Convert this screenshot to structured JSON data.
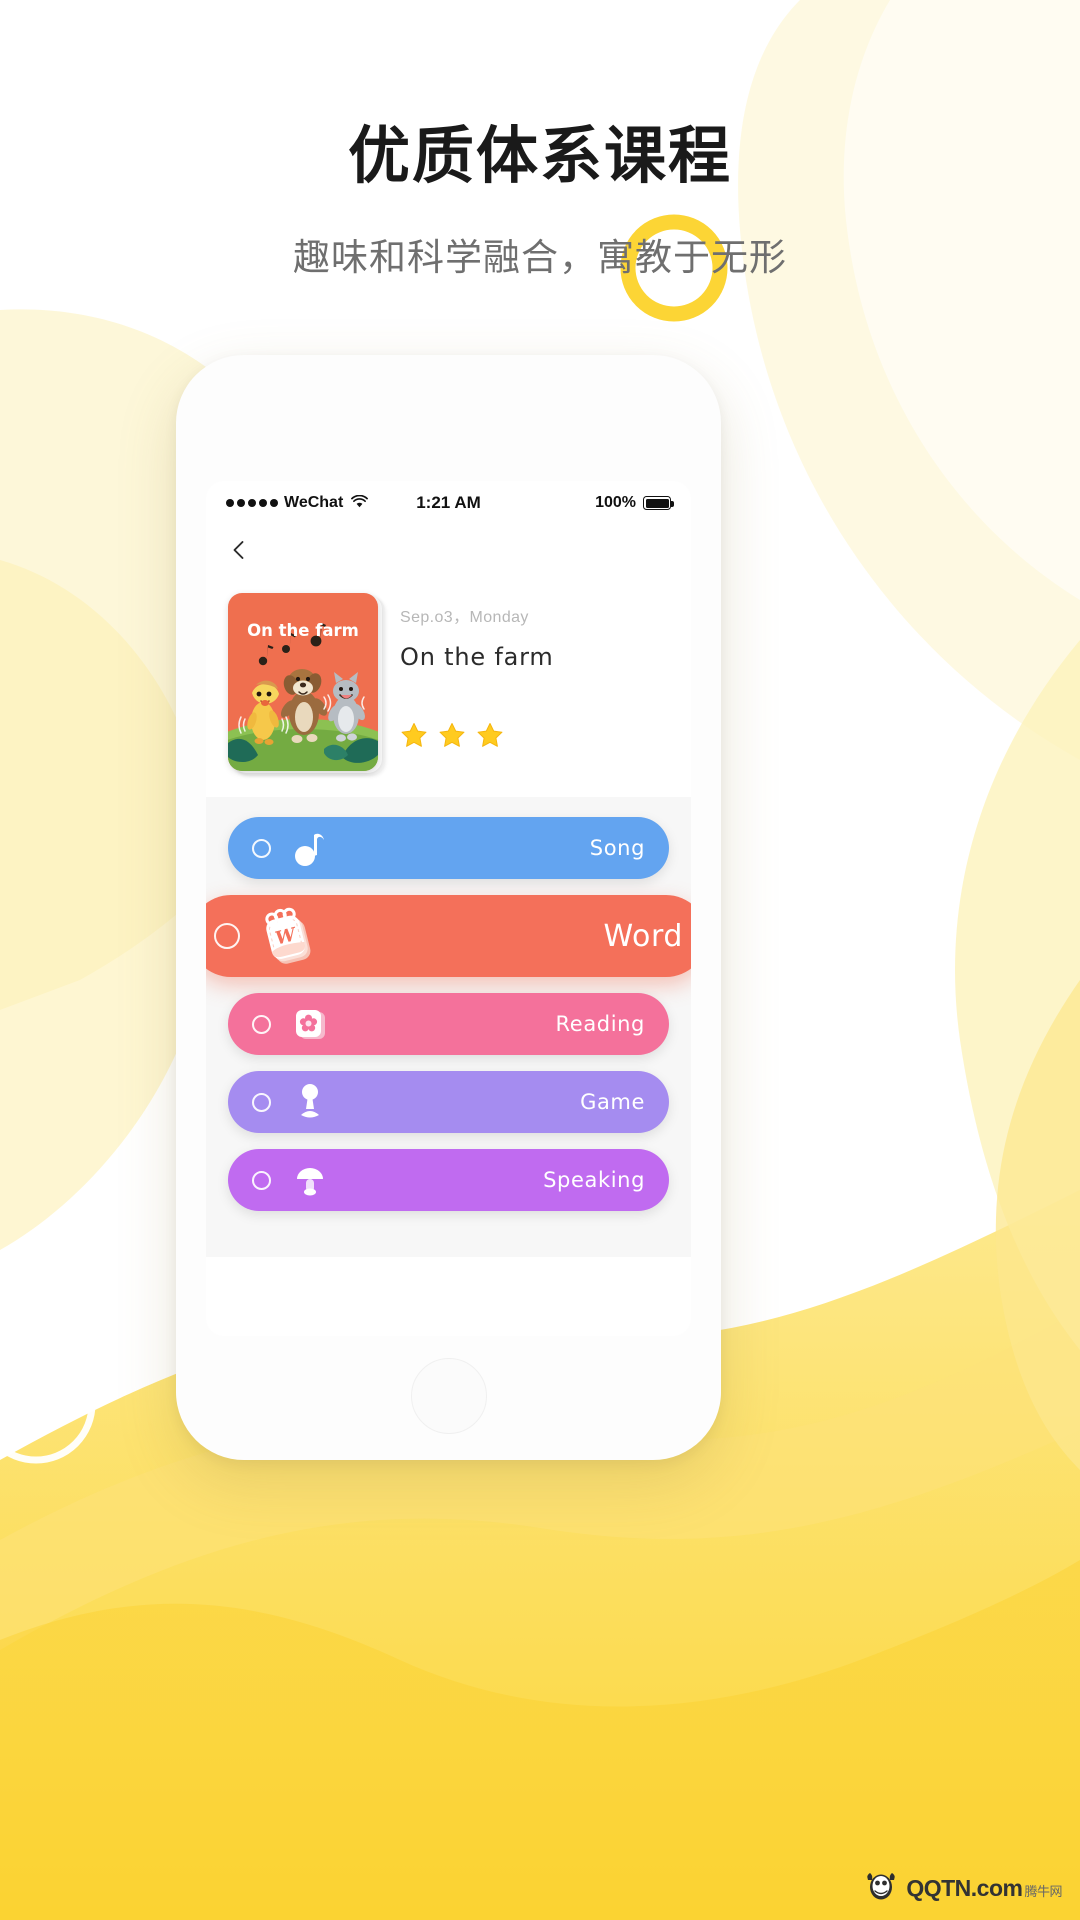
{
  "page": {
    "title": "优质体系课程",
    "subtitle": "趣味和科学融合，寓教于无形",
    "bg_color": "#ffffff",
    "accent_yellow": "#fcd535",
    "accent_light_yellow": "#fdf3c8"
  },
  "phone": {
    "status_bar": {
      "carrier": "WeChat",
      "signal_dots": 5,
      "wifi_icon": "wifi-icon",
      "time": "1:21 AM",
      "battery_percent": "100%",
      "battery_level": 100
    },
    "nav": {
      "back_icon": "chevron-left-icon"
    },
    "lesson": {
      "thumb_title": "On the farm",
      "thumb_bg": "#ef6f4f",
      "date": "Sep.o3，Monday",
      "name": "On the farm",
      "stars_total": 3,
      "stars_filled": 3,
      "star_color": "#ffcb1f"
    },
    "activities": [
      {
        "label": "Song",
        "icon": "music-note-icon",
        "color": "#63a4f0",
        "featured": false
      },
      {
        "label": "Word",
        "icon": "word-card-icon",
        "color": "#f4705a",
        "featured": true
      },
      {
        "label": "Reading",
        "icon": "book-flower-icon",
        "color": "#f4719b",
        "featured": false
      },
      {
        "label": "Game",
        "icon": "joystick-icon",
        "color": "#a58cf0",
        "featured": false
      },
      {
        "label": "Speaking",
        "icon": "microphone-icon",
        "color": "#c06bf0",
        "featured": false
      }
    ]
  },
  "watermark": {
    "brand": "QQTN",
    "suffix": ".com",
    "cn": "腾牛网"
  }
}
